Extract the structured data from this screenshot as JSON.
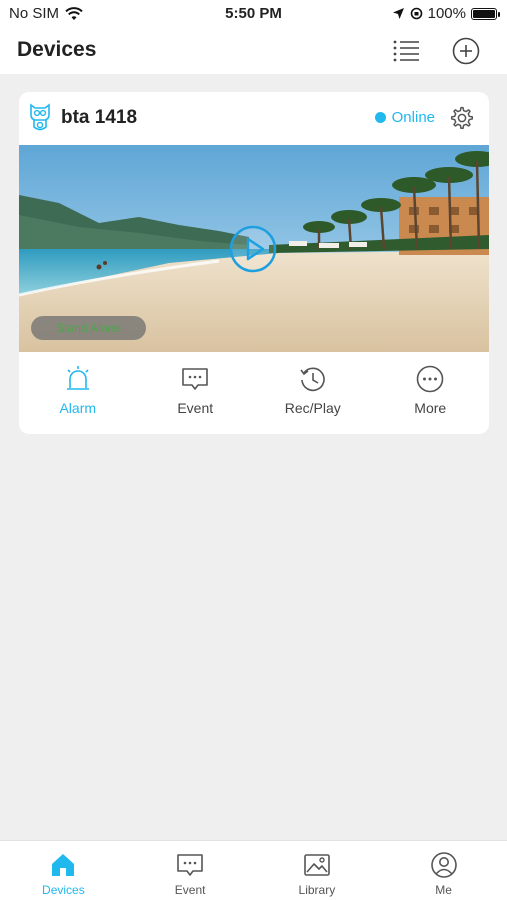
{
  "status_bar": {
    "carrier": "No SIM",
    "time": "5:50 PM",
    "battery": "100%"
  },
  "header": {
    "title": "Devices",
    "list_icon": "list-icon",
    "add_icon": "plus-circle-icon"
  },
  "device": {
    "name": "bta 1418",
    "status": "Online",
    "status_color": "#21b8ee",
    "preview_badge": "Stand Alone",
    "actions": [
      {
        "label": "Alarm",
        "icon": "alarm-siren-icon",
        "active": true
      },
      {
        "label": "Event",
        "icon": "message-icon",
        "active": false
      },
      {
        "label": "Rec/Play",
        "icon": "history-icon",
        "active": false
      },
      {
        "label": "More",
        "icon": "more-icon",
        "active": false
      }
    ]
  },
  "tabs": [
    {
      "label": "Devices",
      "icon": "home-icon",
      "active": true
    },
    {
      "label": "Event",
      "icon": "message-icon",
      "active": false
    },
    {
      "label": "Library",
      "icon": "image-icon",
      "active": false
    },
    {
      "label": "Me",
      "icon": "user-icon",
      "active": false
    }
  ],
  "colors": {
    "accent": "#21b8ee",
    "background": "#efefef"
  }
}
